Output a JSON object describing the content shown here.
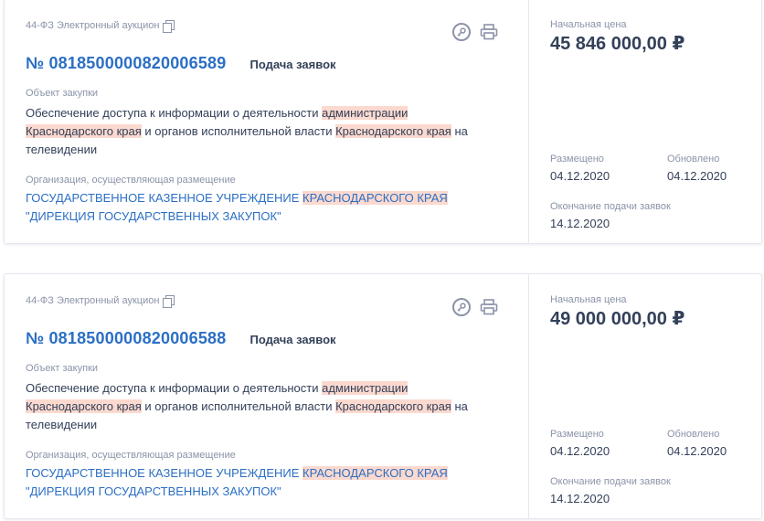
{
  "cards": [
    {
      "law_type": "44-ФЗ Электронный аукцион",
      "number": "№ 0818500000820006589",
      "status": "Подача заявок",
      "object_label": "Объект закупки",
      "object_parts": [
        "Обеспечение доступа к информации о деятельности ",
        "администрации",
        " ",
        "Краснодарского края",
        " и органов исполнительной власти ",
        "Краснодарского края",
        " на телевидении"
      ],
      "org_label": "Организация, осуществляющая размещение",
      "org_parts": [
        "ГОСУДАРСТВЕННОЕ КАЗЕННОЕ УЧРЕЖДЕНИЕ ",
        "КРАСНОДАРСКОГО КРАЯ",
        " \"ДИРЕКЦИЯ ГОСУДАРСТВЕННЫХ ЗАКУПОК\""
      ],
      "price_label": "Начальная цена",
      "price": "45 846 000,00 ₽",
      "placed_label": "Размещено",
      "placed": "04.12.2020",
      "updated_label": "Обновлено",
      "updated": "04.12.2020",
      "deadline_label": "Окончание подачи заявок",
      "deadline": "14.12.2020"
    },
    {
      "law_type": "44-ФЗ Электронный аукцион",
      "number": "№ 0818500000820006588",
      "status": "Подача заявок",
      "object_label": "Объект закупки",
      "object_parts": [
        "Обеспечение доступа к информации о деятельности ",
        "администрации",
        " ",
        "Краснодарского края",
        " и органов исполнительной власти ",
        "Краснодарского края",
        " на телевидении"
      ],
      "org_label": "Организация, осуществляющая размещение",
      "org_parts": [
        "ГОСУДАРСТВЕННОЕ КАЗЕННОЕ УЧРЕЖДЕНИЕ ",
        "КРАСНОДАРСКОГО КРАЯ",
        " \"ДИРЕКЦИЯ ГОСУДАРСТВЕННЫХ ЗАКУПОК\""
      ],
      "price_label": "Начальная цена",
      "price": "49 000 000,00 ₽",
      "placed_label": "Размещено",
      "placed": "04.12.2020",
      "updated_label": "Обновлено",
      "updated": "04.12.2020",
      "deadline_label": "Окончание подачи заявок",
      "deadline": "14.12.2020"
    }
  ],
  "icons": {
    "copy": "copy-icon",
    "key": "key-icon",
    "print": "printer-icon"
  },
  "colors": {
    "link": "#2b6fc4",
    "highlight": "#fbd9cf",
    "muted": "#8a93a8",
    "text": "#334059"
  }
}
